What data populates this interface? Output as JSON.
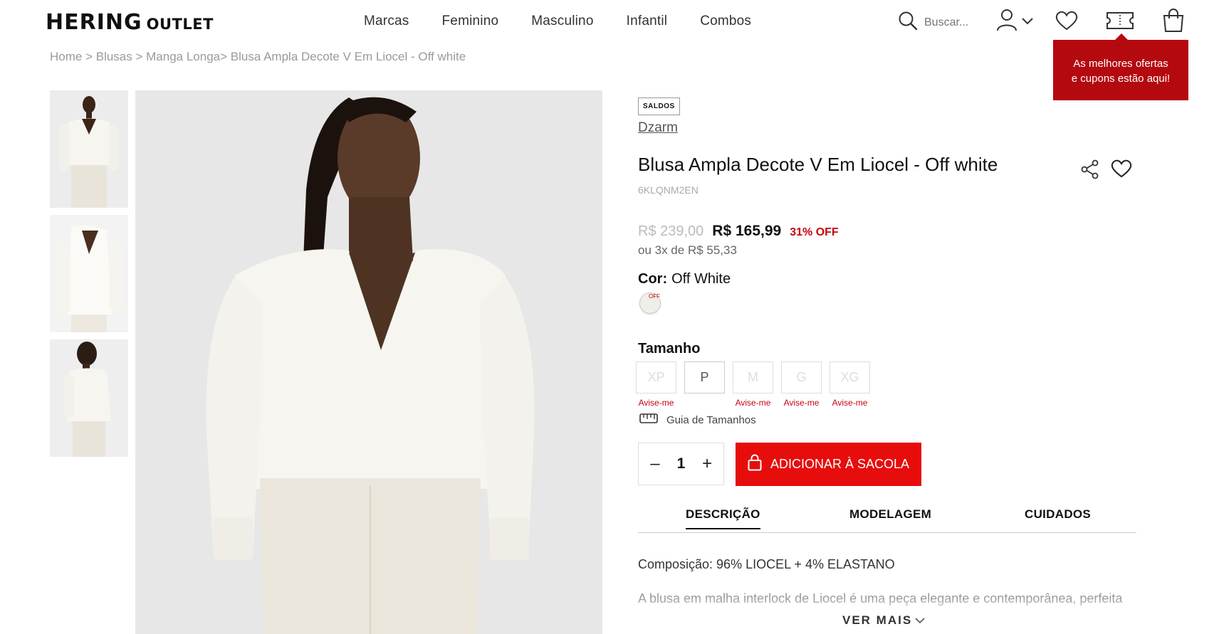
{
  "header": {
    "logo_brand": "HERING",
    "logo_suffix": "OUTLET",
    "nav": [
      "Marcas",
      "Feminino",
      "Masculino",
      "Infantil",
      "Combos"
    ],
    "search_placeholder": "Buscar...",
    "tooltip_line1": "As melhores ofertas",
    "tooltip_line2": "e cupons estão aqui!"
  },
  "breadcrumb": {
    "items": [
      "Home",
      "Blusas",
      "Manga Longa",
      "Blusa Ampla Decote V Em Liocel - Off white"
    ],
    "sep1": " > ",
    "sep2": " > ",
    "sep3": "> "
  },
  "product": {
    "badge": "SALDOS",
    "brand": "Dzarm",
    "title": "Blusa Ampla Decote V Em Liocel - Off white",
    "sku": "6KLQNM2EN",
    "old_price": "R$ 239,00",
    "new_price": "R$ 165,99",
    "discount": "31% OFF",
    "installments": "ou 3x de R$ 55,33",
    "color_label": "Cor:",
    "color_value": "Off White",
    "swatch_label": "OFF",
    "swatch_color": "#f0eee9",
    "size_label": "Tamanho",
    "sizes": [
      {
        "label": "XP",
        "available": false,
        "notice": "Avise-me"
      },
      {
        "label": "P",
        "available": true,
        "notice": ""
      },
      {
        "label": "M",
        "available": false,
        "notice": "Avise-me"
      },
      {
        "label": "G",
        "available": false,
        "notice": "Avise-me"
      },
      {
        "label": "XG",
        "available": false,
        "notice": "Avise-me"
      }
    ],
    "size_guide": "Guia de Tamanhos",
    "quantity": "1",
    "qty_minus": "–",
    "qty_plus": "+",
    "add_to_bag": "ADICIONAR À SACOLA",
    "accent_color": "#e70d0d"
  },
  "tabs": [
    "DESCRIÇÃO",
    "MODELAGEM",
    "CUIDADOS"
  ],
  "description": {
    "composition": "Composição: 96% LIOCEL + 4% ELASTANO",
    "text": "A blusa em malha interlock de Liocel é uma peça elegante e contemporânea, perfeita",
    "ver_mais": "VER MAIS"
  }
}
